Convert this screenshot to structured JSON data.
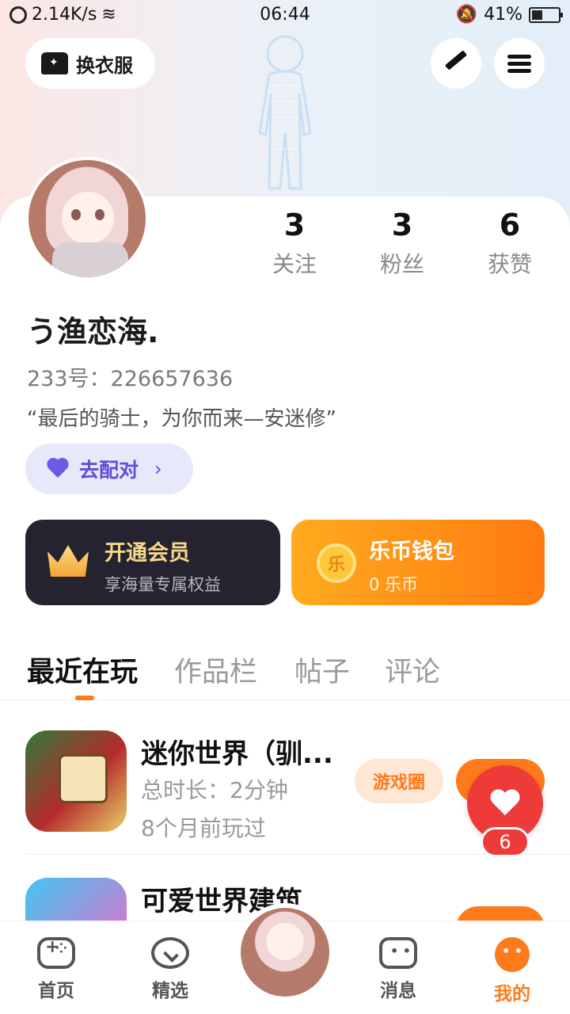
{
  "status_bar": {
    "speed": "2.14K/s",
    "time": "06:44",
    "battery": "41%",
    "battery_level": 0.41
  },
  "header": {
    "wardrobe_label": "换衣服",
    "edit_icon": "pen-icon",
    "menu_icon": "menu-icon"
  },
  "profile": {
    "username": "う渔恋海.",
    "uid": "233号：226657636",
    "bio": "“最后的骑士，为你而来—安迷修”",
    "stats": [
      {
        "value": "3",
        "label": "关注"
      },
      {
        "value": "3",
        "label": "粉丝"
      },
      {
        "value": "6",
        "label": "获赞"
      }
    ],
    "match_label": "去配对"
  },
  "cards": {
    "vip": {
      "title": "开通会员",
      "subtitle": "享海量专属权益"
    },
    "wallet": {
      "icon_text": "乐",
      "title": "乐币钱包",
      "subtitle": "0 乐币"
    }
  },
  "tabs": [
    "最近在玩",
    "作品栏",
    "帖子",
    "评论"
  ],
  "games": [
    {
      "name": "迷你世界（驯...",
      "duration": "总时长：2分钟",
      "last_played": "8个月前玩过",
      "circle_label": "游戏圈"
    },
    {
      "name": "可爱世界建筑",
      "duration": "",
      "last_played": ""
    }
  ],
  "float_like": {
    "count": "6"
  },
  "bottom_nav": [
    {
      "label": "首页",
      "icon": "gamepad-icon"
    },
    {
      "label": "精选",
      "icon": "gem-icon"
    },
    {
      "label": "",
      "icon": "avatar-center"
    },
    {
      "label": "消息",
      "icon": "message-icon"
    },
    {
      "label": "我的",
      "icon": "profile-icon"
    }
  ],
  "colors": {
    "accent": "#ff7a1a",
    "purple": "#5b50d6",
    "vip_gold": "#f5d68a",
    "like_red": "#ef3a3a"
  }
}
